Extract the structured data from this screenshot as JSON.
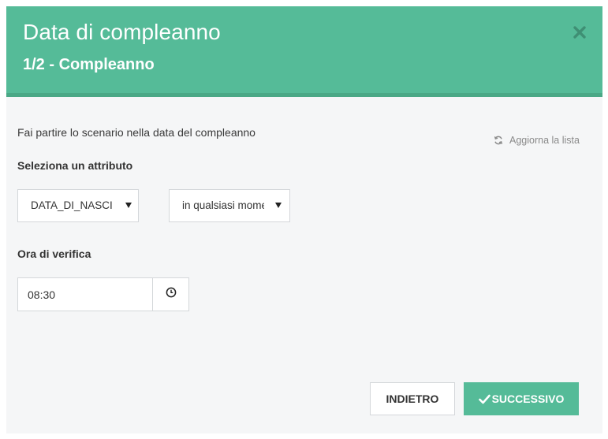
{
  "modal": {
    "title": "Data di compleanno",
    "subtitle": "1/2 - Compleanno",
    "close_icon": "close-icon"
  },
  "body": {
    "intro": "Fai partire lo scenario nella data del compleanno",
    "refresh_label": "Aggiorna la lista",
    "refresh_icon": "refresh-icon",
    "attribute_label": "Seleziona un attributo",
    "attribute_select": "DATA_DI_NASCITA",
    "when_select": "in qualsiasi momento",
    "time_label": "Ora di verifica",
    "time_value": "08:30",
    "clock_icon": "clock-icon"
  },
  "footer": {
    "back_label": "INDIETRO",
    "next_label": "SUCCESSIVO",
    "next_icon": "check-icon"
  },
  "colors": {
    "header": "#55bb98",
    "background": "#f5f6f7"
  }
}
